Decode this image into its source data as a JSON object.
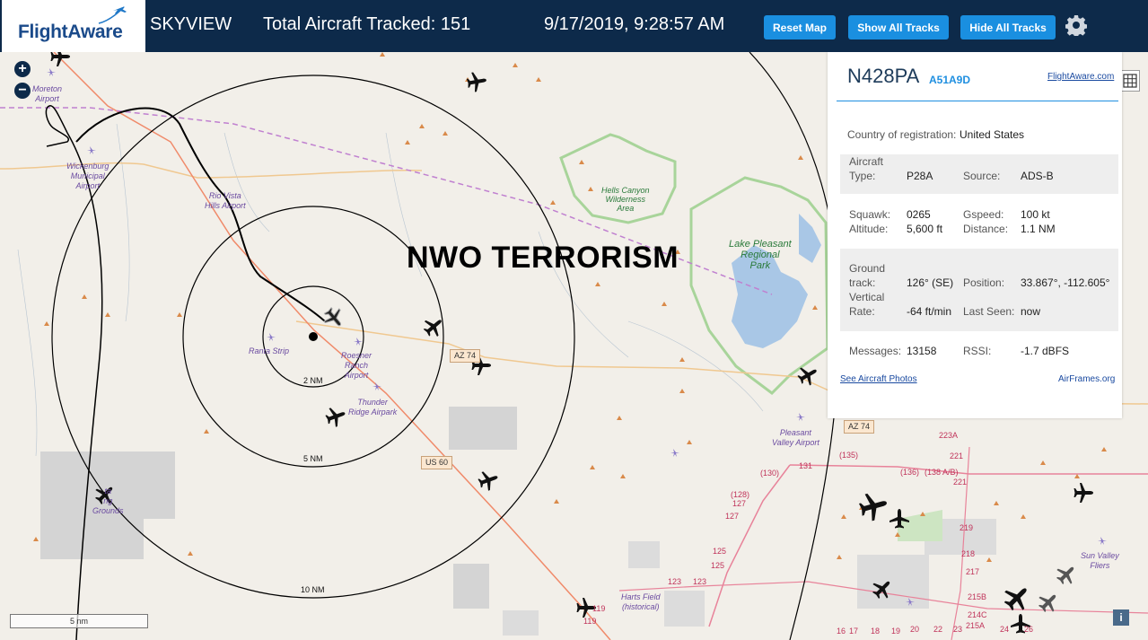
{
  "header": {
    "logo_text": "FlightAware",
    "app_name": "SKYVIEW",
    "total_label": "Total Aircraft Tracked: 151",
    "datetime": "9/17/2019, 9:28:57 AM",
    "buttons": {
      "reset": "Reset Map",
      "show": "Show All Tracks",
      "hide": "Hide All Tracks"
    },
    "settings_icon": "gear-icon"
  },
  "map": {
    "overlay_text": "NWO TERRORISM",
    "zoom_in": "+",
    "zoom_out": "−",
    "scale_label": "5 nm",
    "info_label": "i",
    "ring_labels": [
      "2 NM",
      "5 NM",
      "10 NM"
    ],
    "place_labels": {
      "moreton": "Moreton\nAirport",
      "wickenburg": "Wickenburg\nMunicipal\nAirport",
      "rio_vista": "Rio Vista\nHills Airport",
      "ranta": "Ranta Strip",
      "roesner": "Roesner\nRanch\nAirport",
      "thunder": "Thunder\nRidge Airpark",
      "pleasant_valley": "Pleasant\nValley Airport",
      "harts": "Harts Field\n(historical)",
      "sun_valley": "Sun Valley\nFliers",
      "grounds": "ta\nng\nGrounds"
    },
    "park_labels": {
      "hells_canyon": "Hells Canyon\nWilderness\nArea",
      "lake_pleasant": "Lake Pleasant\nRegional\nPark"
    },
    "roads": {
      "az74_a": "AZ 74",
      "az74_b": "AZ 74",
      "us60": "US 60"
    },
    "route_numbers": [
      "131",
      "(130)",
      "(135)",
      "(136)",
      "(138 A/B)",
      "(128)",
      "127",
      "127",
      "125",
      "125",
      "123",
      "123",
      "119",
      "119",
      "223A",
      "221",
      "221",
      "219",
      "218",
      "217",
      "215B",
      "214C",
      "215A",
      "20",
      "22",
      "23",
      "24",
      "26",
      "17",
      "16",
      "18",
      "19"
    ]
  },
  "panel": {
    "ident": "N428PA",
    "hex": "A51A9D",
    "fa_link": "FlightAware.com",
    "country_label": "Country of registration:",
    "country_value": "United States",
    "rows": {
      "type_label": "Aircraft\nType:",
      "type_value": "P28A",
      "source_label": "Source:",
      "source_value": "ADS-B",
      "squawk_label": "Squawk:\nAltitude:",
      "squawk_value": "0265\n5,600 ft",
      "gspeed_label": "Gspeed:\nDistance:",
      "gspeed_value": "100 kt\n1.1 NM",
      "track_label": "Ground\ntrack:\nVertical\nRate:",
      "track_value": "126° (SE)",
      "vrate_value": "-64 ft/min",
      "position_label": "Position:",
      "position_value": "33.867°, -112.605°",
      "lastseen_label": "Last Seen:",
      "lastseen_value": "now",
      "messages_label": "Messages:",
      "messages_value": "13158",
      "rssi_label": "RSSI:",
      "rssi_value": "-1.7 dBFS"
    },
    "photos_link": "See Aircraft Photos",
    "airframes_link": "AirFrames.org"
  }
}
